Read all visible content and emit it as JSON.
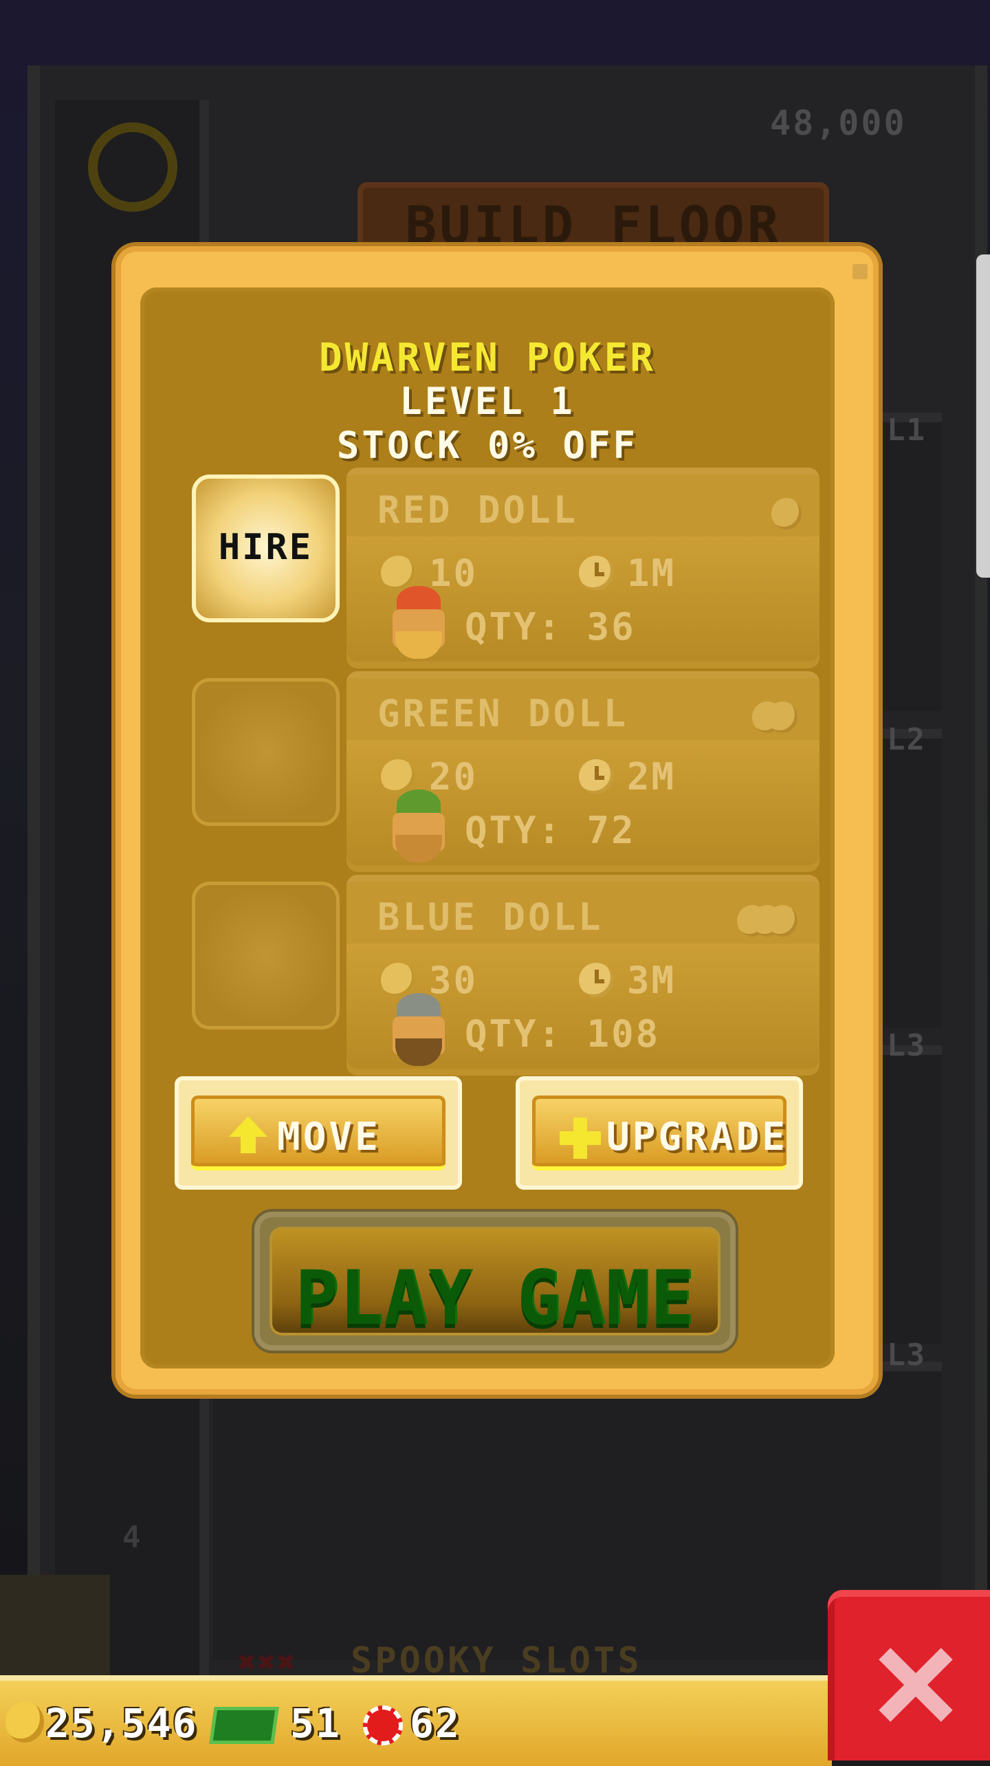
{
  "background": {
    "top_cost": "48,000",
    "build_floor_label": "BUILD FLOOR",
    "floor_labels": [
      "L1",
      "L2",
      "L3",
      "L3"
    ],
    "elevator_floor": "4",
    "bottom_floor_name": "SPOOKY SLOTS"
  },
  "modal": {
    "title": "DWARVEN POKER",
    "level": "LEVEL 1",
    "stock": "STOCK 0% OFF",
    "hire_label": "HIRE",
    "items": [
      {
        "name": "RED DOLL",
        "cost": "10",
        "time": "1M",
        "qty": "QTY: 36",
        "coin_count": 1,
        "hat_color": "#e0552a"
      },
      {
        "name": "GREEN DOLL",
        "cost": "20",
        "time": "2M",
        "qty": "QTY: 72",
        "coin_count": 2,
        "hat_color": "#5f9a2e"
      },
      {
        "name": "BLUE DOLL",
        "cost": "30",
        "time": "3M",
        "qty": "QTY: 108",
        "coin_count": 3,
        "hat_color": "#8a8f86"
      }
    ],
    "move_label": "MOVE",
    "upgrade_label": "UPGRADE",
    "play_label": "PLAY GAME"
  },
  "hud": {
    "coins": "25,546",
    "bux": "51",
    "chips": "62"
  },
  "icons": {
    "coin": "coin-icon",
    "clock": "clock-icon",
    "move": "arrow-up-icon",
    "upgrade": "plus-icon",
    "close": "close-icon",
    "cash": "cash-icon",
    "chip": "chip-icon"
  },
  "colors": {
    "modal_frame": "#f6be50",
    "modal_panel": "#ad7f1a",
    "title_yellow": "#f5e832",
    "play_green": "#0b5a08",
    "close_red": "#e0222c"
  }
}
